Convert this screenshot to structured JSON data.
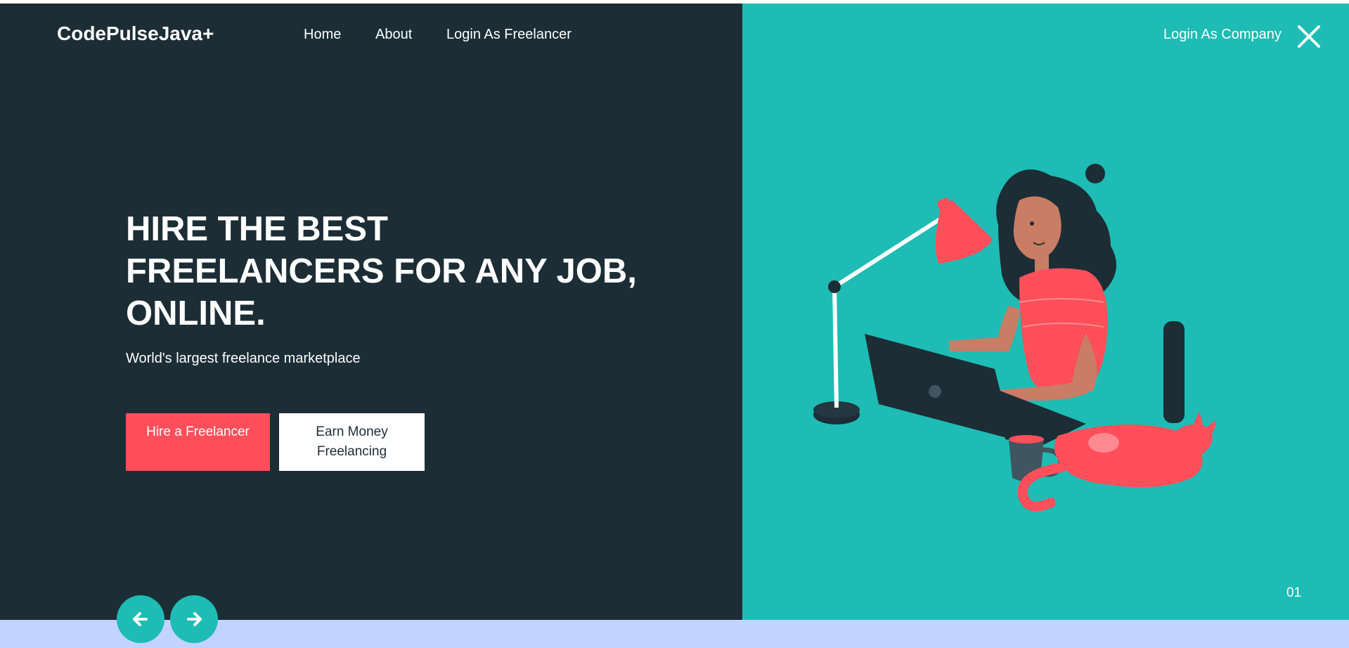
{
  "brand": "CodePulseJava+",
  "nav": {
    "home": "Home",
    "about": "About",
    "login_freelancer": "Login As Freelancer",
    "login_company": "Login As Company"
  },
  "hero": {
    "title_line1": "HIRE THE BEST",
    "title_line2": "FREELANCERS FOR ANY JOB,",
    "title_line3": "ONLINE.",
    "subtitle": "World's largest freelance marketplace",
    "hire_button": "Hire a Freelancer",
    "earn_button": "Earn Money Freelancing"
  },
  "slider": {
    "current": "01"
  },
  "icons": {
    "close": "close-icon",
    "prev": "arrow-left-icon",
    "next": "arrow-right-icon",
    "illustration": "woman-working-at-laptop-illustration"
  },
  "colors": {
    "dark_panel": "#1c2d35",
    "teal_panel": "#1ebcb4",
    "accent_red": "#ff4f5a",
    "bottom_band": "#c2d3fd"
  }
}
